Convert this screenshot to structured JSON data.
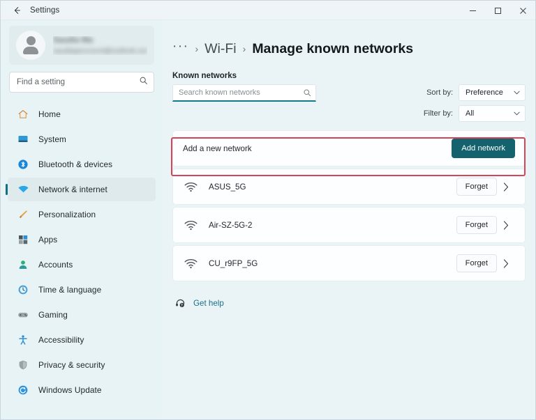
{
  "window": {
    "app_title": "Settings",
    "back_icon": "back-arrow-icon",
    "minimize_label": "–",
    "maximize_label": "□",
    "close_label": "✕"
  },
  "sidebar": {
    "profile": {
      "name": "Saudia Ma",
      "email": "saudiapeccount@outlook.com",
      "avatar_icon": "person-icon"
    },
    "search": {
      "placeholder": "Find a setting",
      "value": "",
      "icon": "search-icon"
    },
    "items": [
      {
        "label": "Home",
        "icon": "home-icon",
        "active": false
      },
      {
        "label": "System",
        "icon": "system-icon",
        "active": false
      },
      {
        "label": "Bluetooth & devices",
        "icon": "bluetooth-icon",
        "active": false
      },
      {
        "label": "Network & internet",
        "icon": "network-wifi-icon",
        "active": true
      },
      {
        "label": "Personalization",
        "icon": "brush-icon",
        "active": false
      },
      {
        "label": "Apps",
        "icon": "apps-icon",
        "active": false
      },
      {
        "label": "Accounts",
        "icon": "account-icon",
        "active": false
      },
      {
        "label": "Time & language",
        "icon": "clock-icon",
        "active": false
      },
      {
        "label": "Gaming",
        "icon": "gamepad-icon",
        "active": false
      },
      {
        "label": "Accessibility",
        "icon": "accessibility-icon",
        "active": false
      },
      {
        "label": "Privacy & security",
        "icon": "shield-icon",
        "active": false
      },
      {
        "label": "Windows Update",
        "icon": "update-icon",
        "active": false
      }
    ]
  },
  "main": {
    "breadcrumb": {
      "overflow": "···",
      "separator": "›",
      "parent": "Wi-Fi",
      "current": "Manage known networks"
    },
    "section_label": "Known networks",
    "known_search": {
      "placeholder": "Search known networks",
      "value": "",
      "icon": "search-icon",
      "focused": true
    },
    "sort": {
      "label": "Sort by:",
      "value": "Preference",
      "chevron": "⌄"
    },
    "filter": {
      "label": "Filter by:",
      "value": "All",
      "chevron": "⌄"
    },
    "add_network": {
      "text": "Add a new network",
      "button_label": "Add network"
    },
    "networks": [
      {
        "name": "ASUS_5G",
        "icon": "wifi-icon",
        "forget_label": "Forget",
        "chevron": "›",
        "highlighted": true
      },
      {
        "name": "Air-SZ-5G-2",
        "icon": "wifi-icon",
        "forget_label": "Forget",
        "chevron": "›",
        "highlighted": false
      },
      {
        "name": "CU_r9FP_5G",
        "icon": "wifi-icon",
        "forget_label": "Forget",
        "chevron": "›",
        "highlighted": false
      }
    ],
    "get_help": {
      "label": "Get help",
      "icon": "help-headset-icon"
    }
  },
  "colors": {
    "accent": "#13626e",
    "background": "#eaf4f7",
    "sidebar": "#e8f3f6",
    "card": "#fdfeff",
    "highlight": "#d64458",
    "link": "#1a6f8a"
  }
}
